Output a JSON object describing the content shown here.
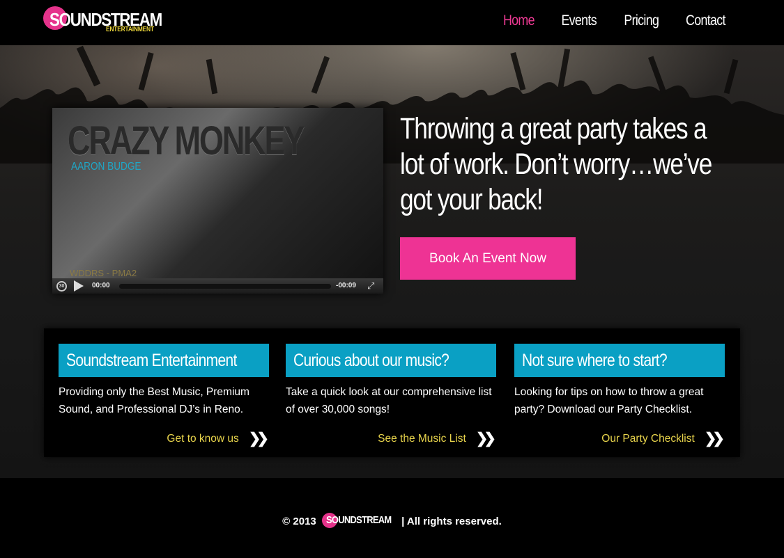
{
  "brand": {
    "name": "SOUNDSTREAM",
    "sub": "ENTERTAINMENT",
    "accent": "#ee3394",
    "blue": "#0aa0c4",
    "link_yellow": "#e9d54c"
  },
  "nav": {
    "items": [
      {
        "label": "Home",
        "active": true
      },
      {
        "label": "Events",
        "active": false
      },
      {
        "label": "Pricing",
        "active": false
      },
      {
        "label": "Contact",
        "active": false
      }
    ]
  },
  "hero": {
    "video": {
      "title": "CRAZY MONKEY",
      "artist": "AARON BUDGE",
      "watermark": "WDDRS - PMA2",
      "current_time": "00:00",
      "remaining_time": "-00:09",
      "rewind_label": "30"
    },
    "headline": "Throwing a great party takes a lot of work. Don’t worry…we’ve got your back!",
    "cta_label": "Book An Event Now"
  },
  "columns": [
    {
      "heading": "Soundstream Entertainment",
      "text": "Providing only the Best Music, Premium Sound, and Professional DJ’s in Reno.",
      "link": "Get to know us"
    },
    {
      "heading": "Curious about our music?",
      "text": "Take a quick look at our comprehensive list of over 30,000 songs!",
      "link": "See the Music List"
    },
    {
      "heading": "Not sure where to start?",
      "text": "Looking for tips on how to throw a great party? Download our Party Checklist.",
      "link": "Our Party Checklist"
    }
  ],
  "footer": {
    "prefix": "© 2013",
    "logo": "SOUNDSTREAM",
    "suffix": "| All rights reserved."
  }
}
